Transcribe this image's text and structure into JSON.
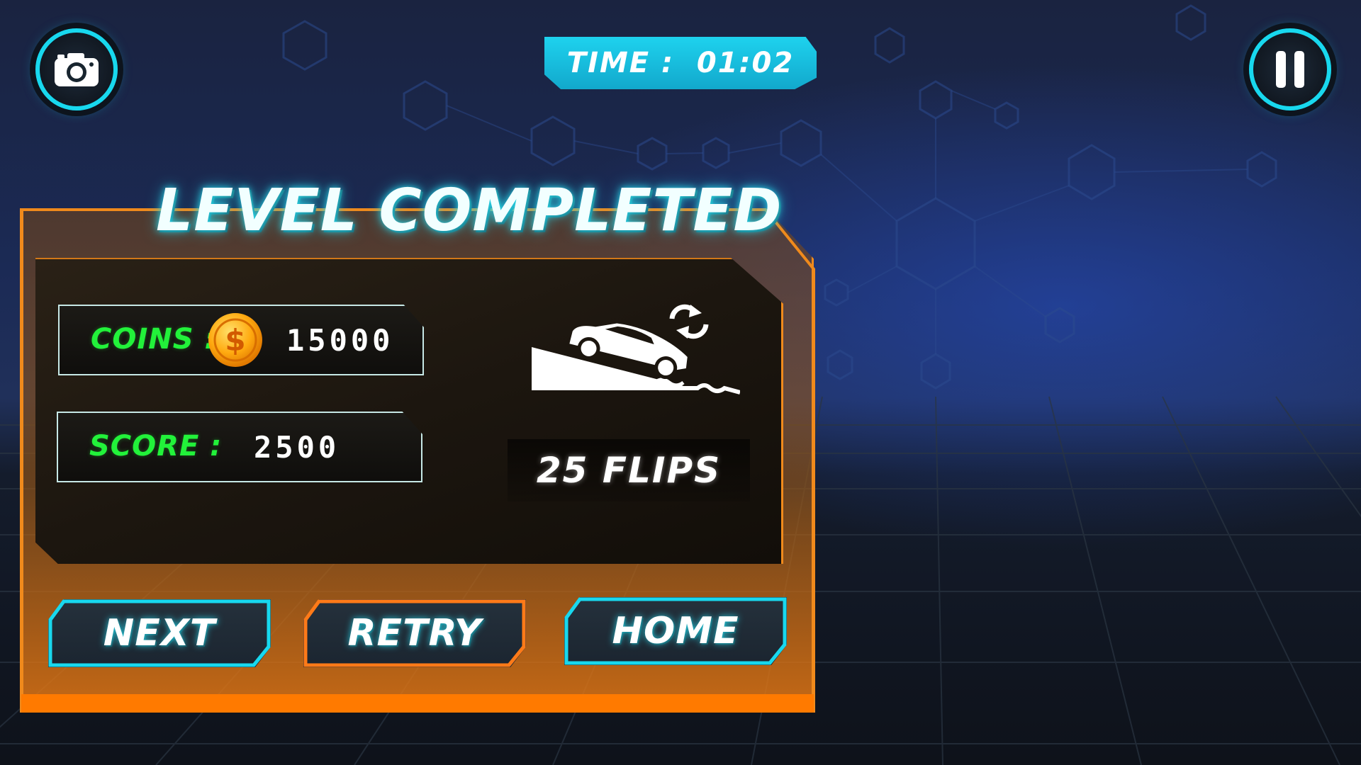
{
  "hud": {
    "camera_icon": "camera-icon",
    "pause_icon": "pause-icon",
    "timer_label": "TIME :",
    "timer_value": "01:02",
    "timer_color": "#1ed2ee"
  },
  "panel": {
    "title": "LEVEL COMPLETED",
    "accent_color": "#f08a1c",
    "coins": {
      "label": "COINS :",
      "icon": "dollar-coin-icon",
      "value": "15000"
    },
    "score": {
      "label": "SCORE :",
      "value": "2500"
    },
    "flips": {
      "icon": "car-flip-ramp-icon",
      "text": "25 FLIPS"
    }
  },
  "buttons": {
    "next": {
      "label": "NEXT",
      "border_color": "#18d8ee"
    },
    "retry": {
      "label": "RETRY",
      "border_color": "#ff7a18"
    },
    "home": {
      "label": "HOME",
      "border_color": "#18d8ee"
    }
  }
}
